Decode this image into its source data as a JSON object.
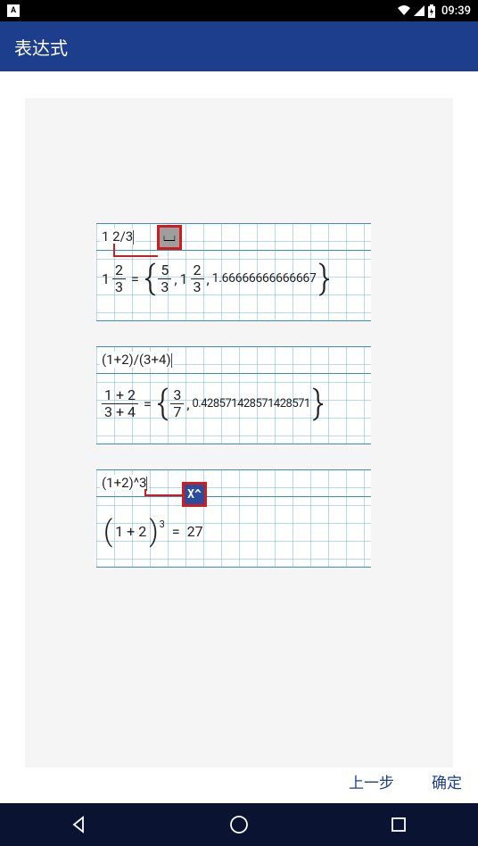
{
  "statusBar": {
    "time": "09:39"
  },
  "appBar": {
    "title": "表达式"
  },
  "expressions": {
    "e1": {
      "input": "1 2/3",
      "int": "1",
      "num": "2",
      "den": "3",
      "rNum": "5",
      "rDen": "3",
      "rInt": "1",
      "rNum2": "2",
      "rDen2": "3",
      "decimal": "1.66666666666667",
      "buttonLabel": "⌴"
    },
    "e2": {
      "input": "(1+2)/(3+4)",
      "lNum": "1 + 2",
      "lDen": "3 + 4",
      "rNum": "3",
      "rDen": "7",
      "decimal": "0.428571428571428571"
    },
    "e3": {
      "input": "(1+2)^3",
      "base": "1 + 2",
      "exponent": "3",
      "result": "27",
      "buttonLabel": "X^"
    }
  },
  "footer": {
    "back": "上一步",
    "confirm": "确定"
  }
}
